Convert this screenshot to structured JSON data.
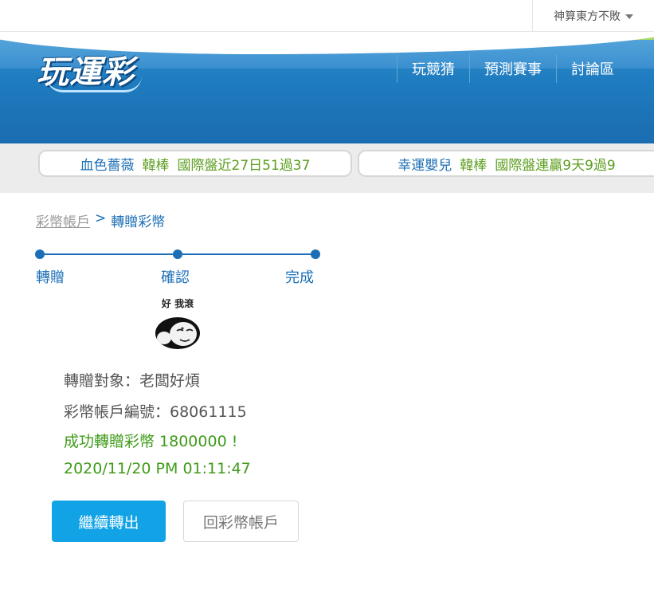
{
  "user_menu": {
    "name": "神算東方不敗"
  },
  "header": {
    "logo": "玩運彩",
    "nav": [
      "玩競猜",
      "預測賽事",
      "討論區"
    ]
  },
  "tickers": [
    {
      "name": "血色薔薇",
      "sport": "韓棒",
      "stat": "國際盤近27日51過37"
    },
    {
      "name": "幸運嬰兒",
      "sport": "韓棒",
      "stat": "國際盤連贏9天9過9"
    }
  ],
  "breadcrumb": {
    "parent": "彩幣帳戶",
    "separator": ">",
    "current": "轉贈彩幣"
  },
  "steps": [
    "轉贈",
    "確認",
    "完成"
  ],
  "avatar": {
    "caption": "好 我滾"
  },
  "result": {
    "recipient": "轉贈對象：老闆好煩",
    "account": "彩幣帳戶編號：68061115",
    "message": "成功轉贈彩幣 1800000 !",
    "timestamp": "2020/11/20 PM 01:11:47"
  },
  "buttons": {
    "continue": "繼續轉出",
    "back": "回彩幣帳戶"
  },
  "colors": {
    "accent": "#1c6fb6",
    "success": "#3f9b1a",
    "primary_button": "#12a3e6"
  }
}
